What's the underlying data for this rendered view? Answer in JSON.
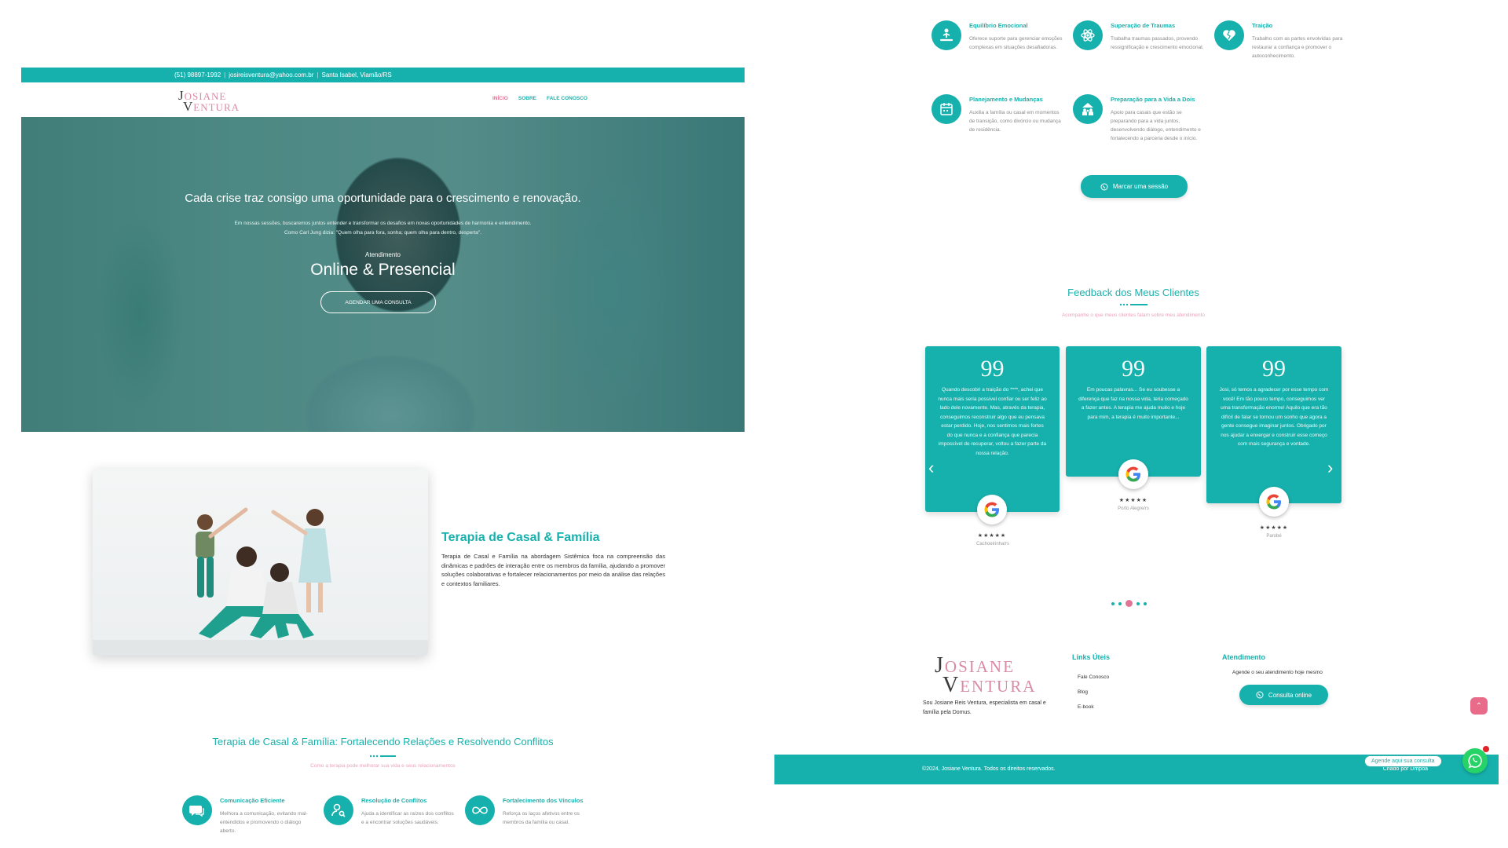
{
  "colors": {
    "teal": "#17b1ad",
    "pink": "#e07596",
    "light_pink": "#e8a3b8",
    "whatsapp": "#25d366"
  },
  "topbar": {
    "phone": "(51) 98897-1992",
    "email": "josireisventura@yahoo.com.br",
    "location": "Santa Isabel, Viamão/RS"
  },
  "logo": {
    "line1": "OSIANE",
    "line2": "ENTURA",
    "initial1": "J",
    "initial2": "V"
  },
  "nav": {
    "items": [
      {
        "label": "INÍCIO"
      },
      {
        "label": "SOBRE"
      },
      {
        "label": "FALE CONOSCO"
      }
    ]
  },
  "hero": {
    "headline": "Cada crise traz consigo uma oportunidade para o crescimento e renovação.",
    "paragraph_line1": "Em nossas sessões, buscaremos juntos entender e transformar os desafios em novas oportunidades de harmonia e entendimento.",
    "paragraph_line2": "Como Carl Jung dizia: \"Quem olha para fora, sonha; quem olha para dentro, desperta\".",
    "kicker": "Atendimento",
    "title": "Online & Presencial",
    "cta": "AGENDAR UMA CONSULTA"
  },
  "couple": {
    "title": "Terapia de Casal & Família",
    "text": "Terapia de Casal e Família na abordagem Sistêmica foca na compreensão das dinâmicas e padrões de interação entre os membros da família, ajudando a promover soluções colaborativas e fortalecer relacionamentos por meio da análise das relações e contextos familiares."
  },
  "section": {
    "title": "Terapia de Casal & Família: Fortalecendo Relações e Resolvendo Conflitos",
    "subtitle": "Como a terapia pode melhorar sua vida e seus relacionamentos"
  },
  "features_left": [
    {
      "title": "Comunicação Eficiente",
      "desc": "Melhora a comunicação, evitando mal-entendidos e promovendo o diálogo aberto.",
      "icon": "chat-icon"
    },
    {
      "title": "Resolução de Conflitos",
      "desc": "Ajuda a identificar as raízes dos conflitos e a encontrar soluções saudáveis.",
      "icon": "person-search-icon"
    },
    {
      "title": "Fortalecimento dos Vínculos",
      "desc": "Reforça os laços afetivos entre os membros da família ou casal.",
      "icon": "infinity-icon"
    }
  ],
  "features_right": [
    {
      "title": "Equilíbrio Emocional",
      "desc": "Oferece suporte para gerenciar emoções complexas em situações desafiadoras.",
      "icon": "meditation-icon"
    },
    {
      "title": "Superação de Traumas",
      "desc": "Trabalha traumas passados, provendo ressignificação e crescimento emocional.",
      "icon": "atom-icon"
    },
    {
      "title": "Traição",
      "desc": "Trabalho com as partes envolvidas para restaurar a confiança e promover o autoconhecimento.",
      "icon": "broken-heart-icon"
    },
    {
      "title": "Planejamento e Mudanças",
      "desc": "Auxilia a família ou casal em momentos de transição, como divórcio ou mudança de residência.",
      "icon": "calendar-icon"
    },
    {
      "title": "Preparação para a Vida a Dois",
      "desc": "Apoio para casais que estão se preparando para a vida juntos, desenvolvendo diálogo, entendimento e fortalecendo a parceria desde o início.",
      "icon": "family-icon"
    }
  ],
  "session_button": "Marcar uma sessão",
  "feedback": {
    "title": "Feedback dos Meus Clientes",
    "subtitle": "Acompanhe o que meus clientes falam sobre meu atendimento",
    "cards": [
      {
        "text": "Quando descobri a traição do ****, achei que nunca mais seria possível confiar ou ser feliz ao lado dele novamente. Mas, através da terapia, conseguimos reconstruir algo que eu pensava estar perdido. Hoje, nos sentimos mais fortes do que nunca e a confiança que parecia impossível de recuperar, voltou a fazer parte da nossa relação.",
        "stars": "★★★★★",
        "name": "Cachoeirinha/rs"
      },
      {
        "text": "Em poucas palavras... Se eu soubesse a diferença que faz na nossa vida, teria começado a fazer antes. A terapia me ajuda muito e hoje para mim, a terapia é muito importante...",
        "stars": "★★★★★",
        "name": "Porto Alegre/rs"
      },
      {
        "text": "Josi, só temos a agradecer por esse tempo com você! Em tão pouco tempo, conseguimos ver uma transformação enorme! Aquilo que era tão difícil de falar se tornou um sonho que agora a gente consegue imaginar juntos. Obrigado por nos ajudar a enxergar e construir esse começo com mais segurança e vontade.",
        "stars": "★★★★★",
        "name": "Parobé"
      }
    ]
  },
  "carousel": {
    "dots": 5,
    "active": 2
  },
  "footer": {
    "logo_line1": "OSIANE",
    "logo_line2": "ENTURA",
    "description": "Sou Josiane Reis Ventura, especialista em casal e família pela Domus.",
    "links_title": "Links Úteis",
    "links": [
      {
        "label": "Fale Conosco"
      },
      {
        "label": "Blog"
      },
      {
        "label": "E-book"
      }
    ],
    "service_title": "Atendimento",
    "service_text": "Agende o seu atendimento hoje mesmo",
    "service_button": "Consulta online",
    "copyright": "©2024, Josiane Ventura. Todos os direitos reservados.",
    "credit": "Criado por Dmpoa"
  },
  "whatsapp": {
    "pill": "Agende aqui sua consulta"
  }
}
